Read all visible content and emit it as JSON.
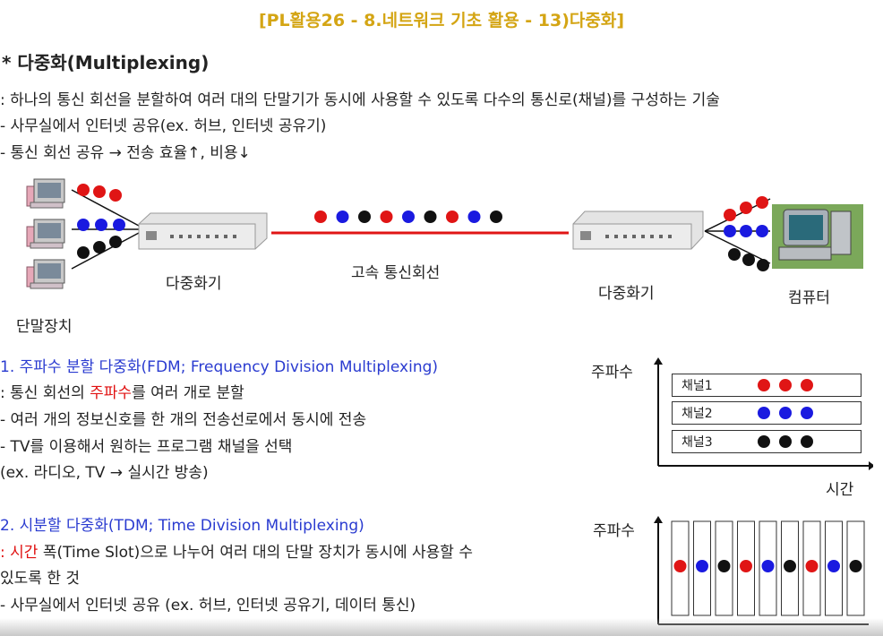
{
  "header": {
    "title": "[PL활용26 - 8.네트워크 기초 활용 - 13)다중화]"
  },
  "heading": "* 다중화(Multiplexing)",
  "definition": ": 하나의 통신 회선을 분할하여 여러 대의 단말기가 동시에 사용할 수 있도록 다수의 통신로(채널)를 구성하는 기술",
  "bullets_top": [
    "- 사무실에서 인터넷 공유(ex. 허브, 인터넷 공유기)",
    "- 통신 회선 공유 → 전송 효율↑, 비용↓"
  ],
  "diagram": {
    "mux_left_label": "다중화기",
    "line_label": "고속 통신회선",
    "mux_right_label": "다중화기",
    "terminal_label": "단말장치",
    "computer_label": "컴퓨터",
    "colors": {
      "red": "#e01515",
      "blue": "#1a1ae0",
      "black": "#111111",
      "line": "#e01515"
    },
    "stream": [
      "red",
      "blue",
      "black",
      "red",
      "blue",
      "black",
      "red",
      "blue",
      "black"
    ]
  },
  "fdm": {
    "title": "1. 주파수 분할 다중화(FDM; Frequency Division Multiplexing)",
    "def_prefix": ": 통신 회선의 ",
    "def_red": "주파수",
    "def_suffix": "를 여러 개로 분할",
    "items": [
      "- 여러 개의 정보신호를 한 개의 전송선로에서 동시에 전송",
      "- TV를 이용해서 원하는 프로그램 채널을 선택",
      "(ex. 라디오, TV → 실시간 방송)"
    ],
    "chart": {
      "y_label": "주파수",
      "x_label": "시간",
      "channels": [
        {
          "name": "채널1",
          "color": "red"
        },
        {
          "name": "채널2",
          "color": "blue"
        },
        {
          "name": "채널3",
          "color": "black"
        }
      ]
    }
  },
  "tdm": {
    "title": "2. 시분할 다중화(TDM; Time Division Multiplexing)",
    "def_red": ": 시간",
    "def_rest1": " 폭(Time Slot)으로 나누어 여러 대의 단말 장치가 동시에 사용할 수",
    "def_rest2": "있도록 한 것",
    "item": "- 사무실에서 인터넷 공유 (ex. 허브, 인터넷 공유기, 데이터 통신)",
    "chart": {
      "y_label": "주파수",
      "slots": [
        "red",
        "blue",
        "black",
        "red",
        "blue",
        "black",
        "red",
        "blue",
        "black"
      ]
    }
  }
}
